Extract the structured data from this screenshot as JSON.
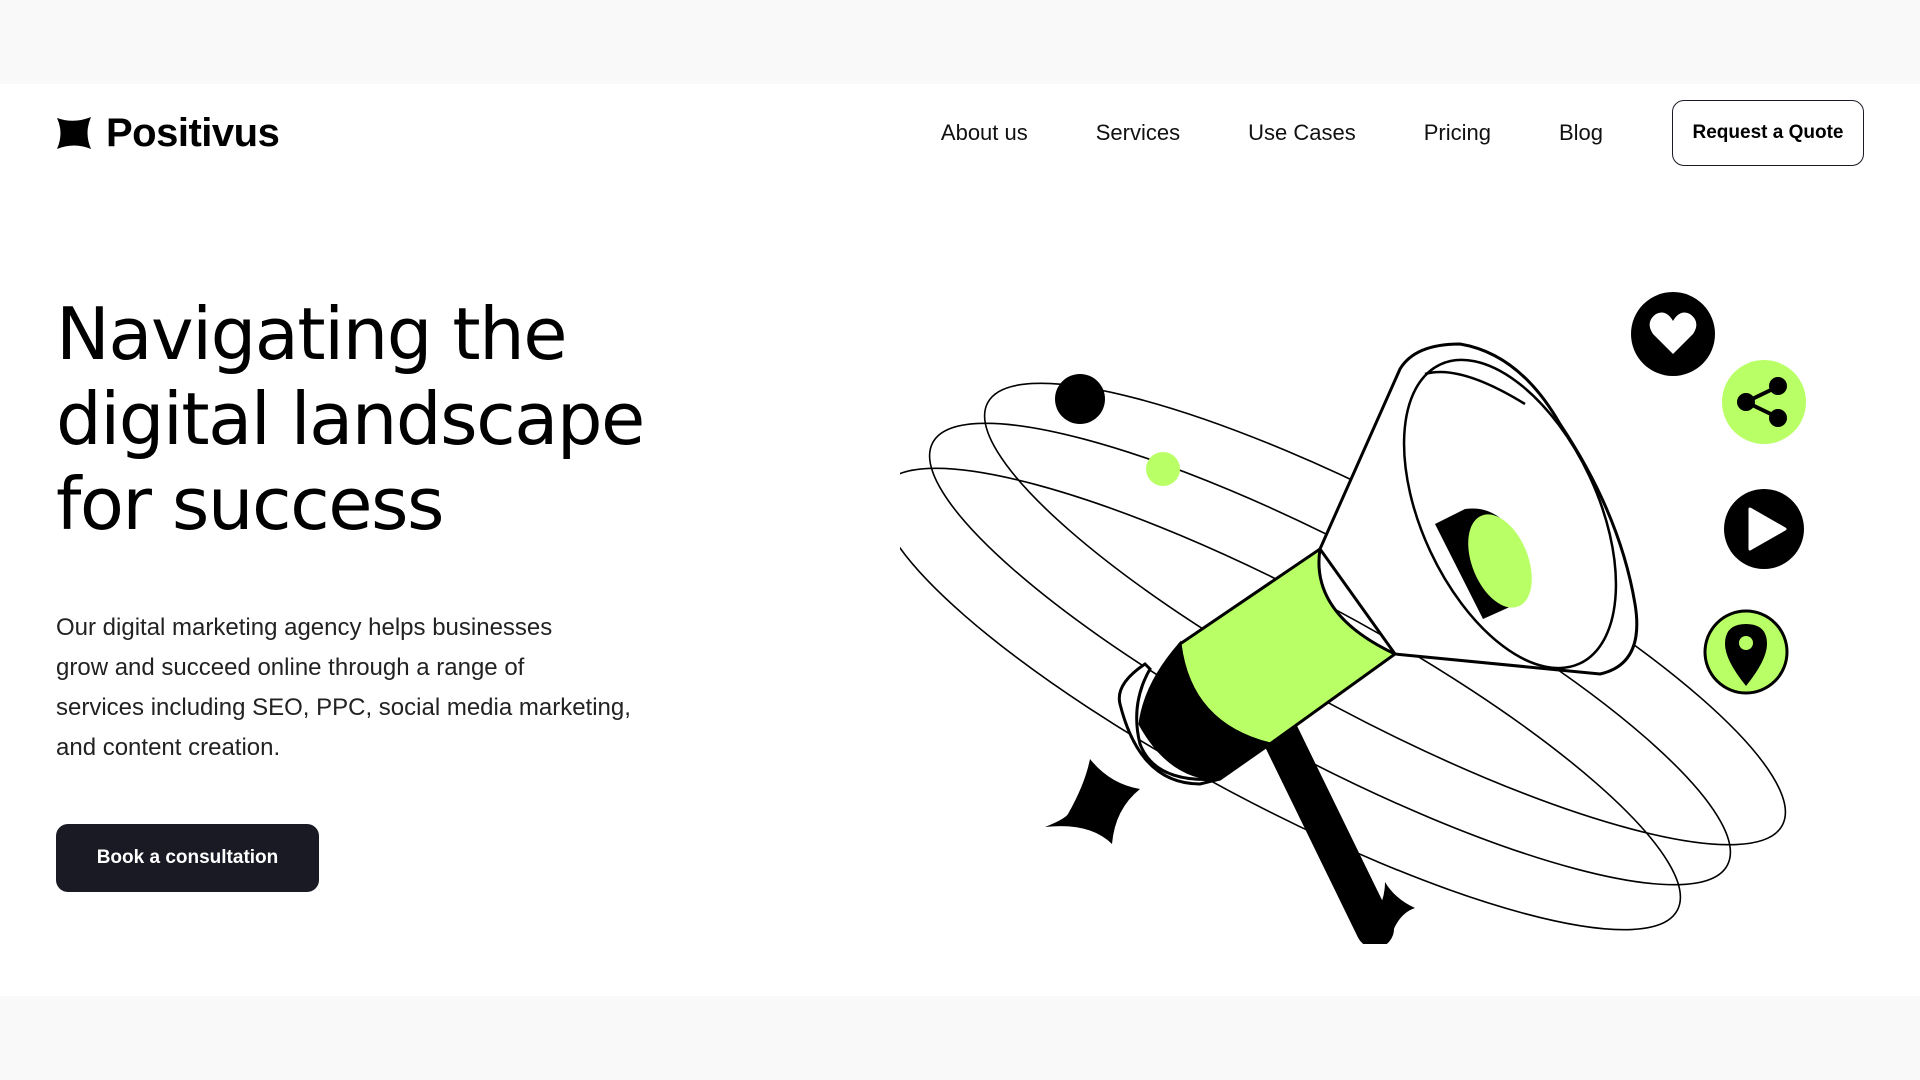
{
  "brand": {
    "name": "Positivus",
    "logo_icon": "sparkle-icon"
  },
  "nav": {
    "links": [
      "About us",
      "Services",
      "Use Cases",
      "Pricing",
      "Blog"
    ],
    "cta_label": "Request a Quote"
  },
  "hero": {
    "title_lines": [
      "Navigating the",
      "digital landscape",
      "for success"
    ],
    "description_lines": [
      "Our digital marketing agency helps businesses",
      "grow and succeed online through a range of",
      "services including SEO, PPC, social media marketing,",
      "and content creation."
    ],
    "cta_label": "Book a consultation"
  },
  "illustration": {
    "subject": "megaphone",
    "icons": [
      "heart-icon",
      "share-icon",
      "play-icon",
      "location-pin-icon"
    ]
  },
  "colors": {
    "accent": "#B9FF66",
    "dark": "#191A23",
    "background": "#FFFFFF",
    "outer_background": "#F9F9F9"
  }
}
